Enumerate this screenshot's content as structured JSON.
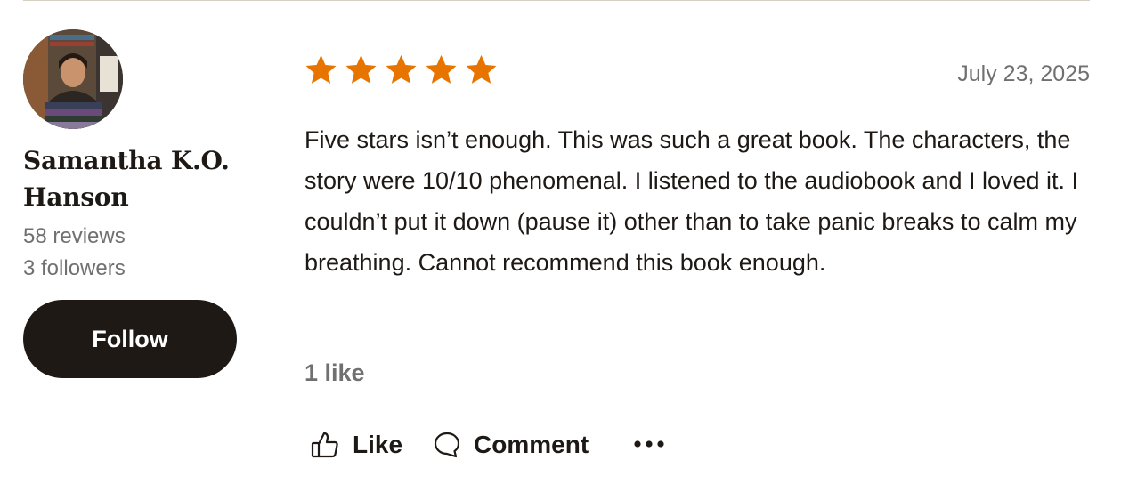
{
  "reviewer": {
    "name": "Samantha K.O. Hanson",
    "reviews": "58 reviews",
    "followers": "3 followers",
    "follow_label": "Follow",
    "avatar_icon": "profile-photo"
  },
  "review": {
    "rating": 5,
    "rating_max": 5,
    "star_color": "#e87400",
    "date": "July 23, 2025",
    "text": "Five stars isn’t enough. This was such a great book. The characters, the story were 10/10 phenomenal. I listened to the audiobook and I loved it. I couldn’t put it down (pause it) other than to take panic breaks to calm my breathing. Cannot recommend this book enough.",
    "likes": "1 like"
  },
  "actions": {
    "like_label": "Like",
    "comment_label": "Comment",
    "like_icon": "thumbs-up-icon",
    "comment_icon": "speech-bubble-icon",
    "more_icon": "more-horizontal-icon"
  },
  "colors": {
    "text": "#1e1915",
    "muted": "#707070",
    "button_bg": "#1e1915",
    "divider": "#d6d0c4"
  }
}
